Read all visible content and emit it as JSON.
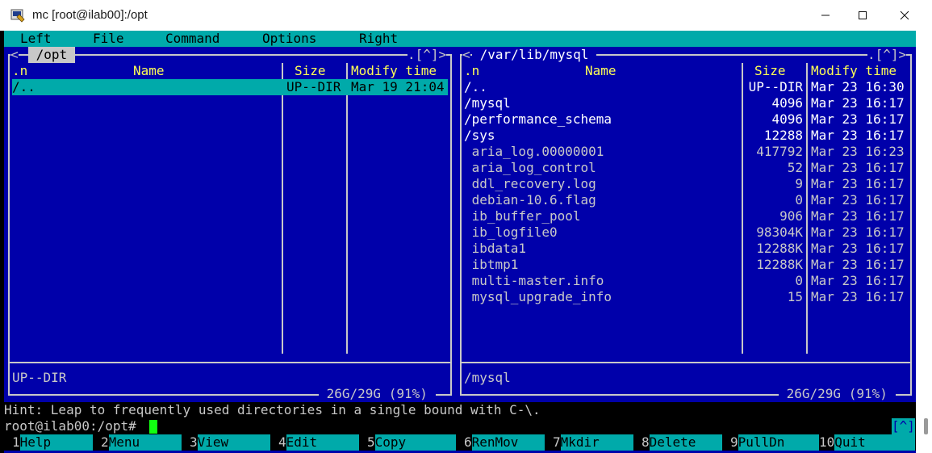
{
  "window": {
    "title": "mc [root@ilab00]:/opt",
    "icons": {
      "app": "terminal-app-icon",
      "minimize": "minimize-icon",
      "maximize": "maximize-icon",
      "close": "close-icon"
    }
  },
  "menu": {
    "items": [
      "Left",
      "File",
      "Command",
      "Options",
      "Right"
    ]
  },
  "left_panel": {
    "path": " /opt ",
    "corner": ".[^]>",
    "corner_open": "<",
    "headers": {
      "n": ".n",
      "name": "Name",
      "size": "Size",
      "time": "Modify time"
    },
    "rows": [
      {
        "name": "/..",
        "size": "UP--DIR",
        "time": "Mar 19 21:04"
      }
    ],
    "status": "UP--DIR",
    "disk": " 26G/29G (91%) "
  },
  "right_panel": {
    "path": " /var/lib/mysql ",
    "corner": ".[^]>",
    "corner_open": "<",
    "headers": {
      "n": ".n",
      "name": "Name",
      "size": "Size",
      "time": "Modify time"
    },
    "rows": [
      {
        "name": "/..",
        "size": "UP--DIR",
        "time": "Mar 23 16:30",
        "kind": "dir"
      },
      {
        "name": "/mysql",
        "size": "4096",
        "time": "Mar 23 16:17",
        "kind": "dir"
      },
      {
        "name": "/performance_schema",
        "size": "4096",
        "time": "Mar 23 16:17",
        "kind": "dir"
      },
      {
        "name": "/sys",
        "size": "12288",
        "time": "Mar 23 16:17",
        "kind": "dir"
      },
      {
        "name": " aria_log.00000001",
        "size": "417792",
        "time": "Mar 23 16:23",
        "kind": "file"
      },
      {
        "name": " aria_log_control",
        "size": "52",
        "time": "Mar 23 16:17",
        "kind": "file"
      },
      {
        "name": " ddl_recovery.log",
        "size": "9",
        "time": "Mar 23 16:17",
        "kind": "file"
      },
      {
        "name": " debian-10.6.flag",
        "size": "0",
        "time": "Mar 23 16:17",
        "kind": "file"
      },
      {
        "name": " ib_buffer_pool",
        "size": "906",
        "time": "Mar 23 16:17",
        "kind": "file"
      },
      {
        "name": " ib_logfile0",
        "size": "98304K",
        "time": "Mar 23 16:17",
        "kind": "file"
      },
      {
        "name": " ibdata1",
        "size": "12288K",
        "time": "Mar 23 16:17",
        "kind": "file"
      },
      {
        "name": " ibtmp1",
        "size": "12288K",
        "time": "Mar 23 16:17",
        "kind": "file"
      },
      {
        "name": " multi-master.info",
        "size": "0",
        "time": "Mar 23 16:17",
        "kind": "file"
      },
      {
        "name": " mysql_upgrade_info",
        "size": "15",
        "time": "Mar 23 16:17",
        "kind": "file"
      }
    ],
    "status": "/mysql",
    "disk": " 26G/29G (91%) "
  },
  "hint": "Hint: Leap to frequently used directories in a single bound with C-\\.",
  "prompt": "root@ilab00:/opt#",
  "prompt_right": "[^]",
  "keys": [
    {
      "num": "1",
      "label": "Help"
    },
    {
      "num": "2",
      "label": "Menu"
    },
    {
      "num": "3",
      "label": "View"
    },
    {
      "num": "4",
      "label": "Edit"
    },
    {
      "num": "5",
      "label": "Copy"
    },
    {
      "num": "6",
      "label": "RenMov"
    },
    {
      "num": "7",
      "label": "Mkdir"
    },
    {
      "num": "8",
      "label": "Delete"
    },
    {
      "num": "9",
      "label": "PullDn"
    },
    {
      "num": "10",
      "label": "Quit"
    }
  ],
  "colors": {
    "panel_bg": "#0000aa",
    "cyan": "#00aaaa",
    "header": "#ffff55",
    "cursor": "#11ff11"
  }
}
